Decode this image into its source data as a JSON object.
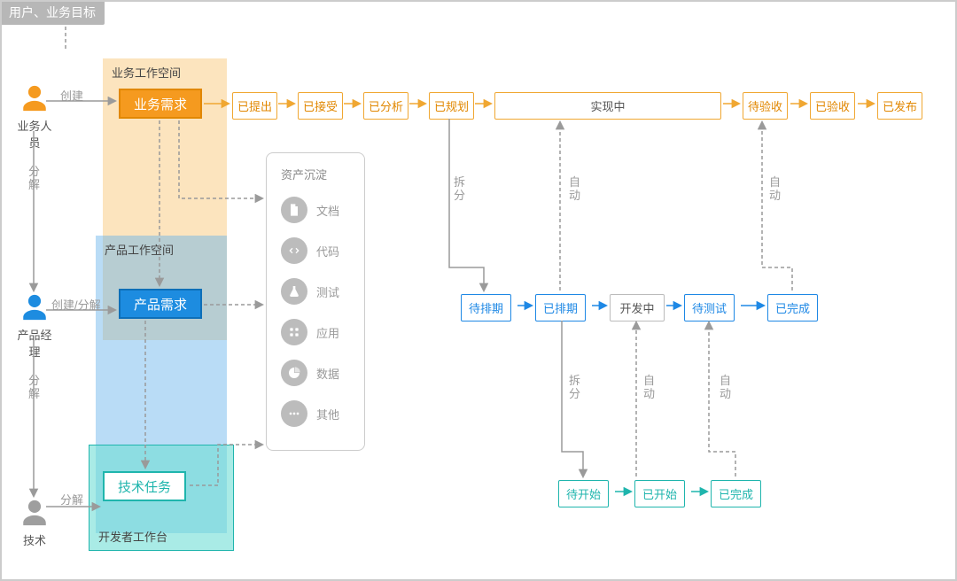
{
  "corner_label": "用户、业务目标",
  "actors": {
    "business": "业务人员",
    "product": "产品经理",
    "tech": "技术"
  },
  "actor_edge_labels": {
    "create": "创建",
    "decompose": "分解",
    "create_decompose": "创建/分解"
  },
  "workspaces": {
    "business": {
      "title": "业务工作空间",
      "node": "业务需求"
    },
    "product": {
      "title": "产品工作空间",
      "node": "产品需求"
    },
    "tech": {
      "title": "开发者工作台",
      "node": "技术任务"
    }
  },
  "row1_states": [
    "已提出",
    "已接受",
    "已分析",
    "已规划",
    "实现中",
    "待验收",
    "已验收",
    "已发布"
  ],
  "row2_states": [
    "待排期",
    "已排期",
    "开发中",
    "待测试",
    "已完成"
  ],
  "row3_states": [
    "待开始",
    "已开始",
    "已完成"
  ],
  "vertical_edge_labels": {
    "split": "拆分",
    "auto": "自动"
  },
  "assets": {
    "title": "资产沉淀",
    "items": [
      "文档",
      "代码",
      "测试",
      "应用",
      "数据",
      "其他"
    ]
  }
}
